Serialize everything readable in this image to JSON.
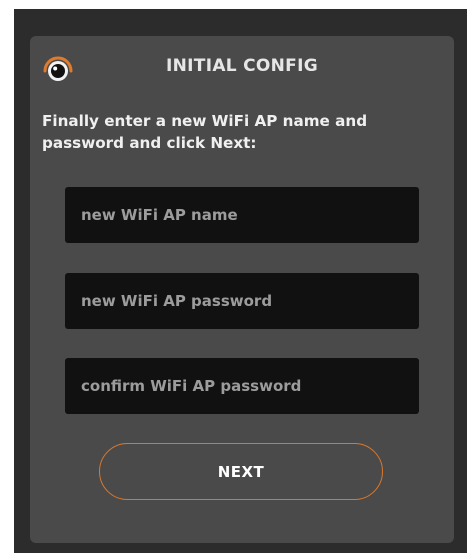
{
  "header": {
    "title": "INITIAL CONFIG",
    "logo_icon": "eye-logo-icon"
  },
  "instructions": "Finally enter a new WiFi AP name and password and click Next:",
  "form": {
    "ap_name": {
      "value": "",
      "placeholder": "new WiFi AP name"
    },
    "ap_password": {
      "value": "",
      "placeholder": "new WiFi AP password"
    },
    "ap_password_confirm": {
      "value": "",
      "placeholder": "confirm WiFi AP password"
    }
  },
  "next_label": "NEXT",
  "colors": {
    "page_background": "#2c2c2c",
    "card_background": "#4a4a4a",
    "input_background": "#111111",
    "accent": "#d9782d",
    "text": "#f0f0f0",
    "placeholder": "#9c9c9c"
  }
}
